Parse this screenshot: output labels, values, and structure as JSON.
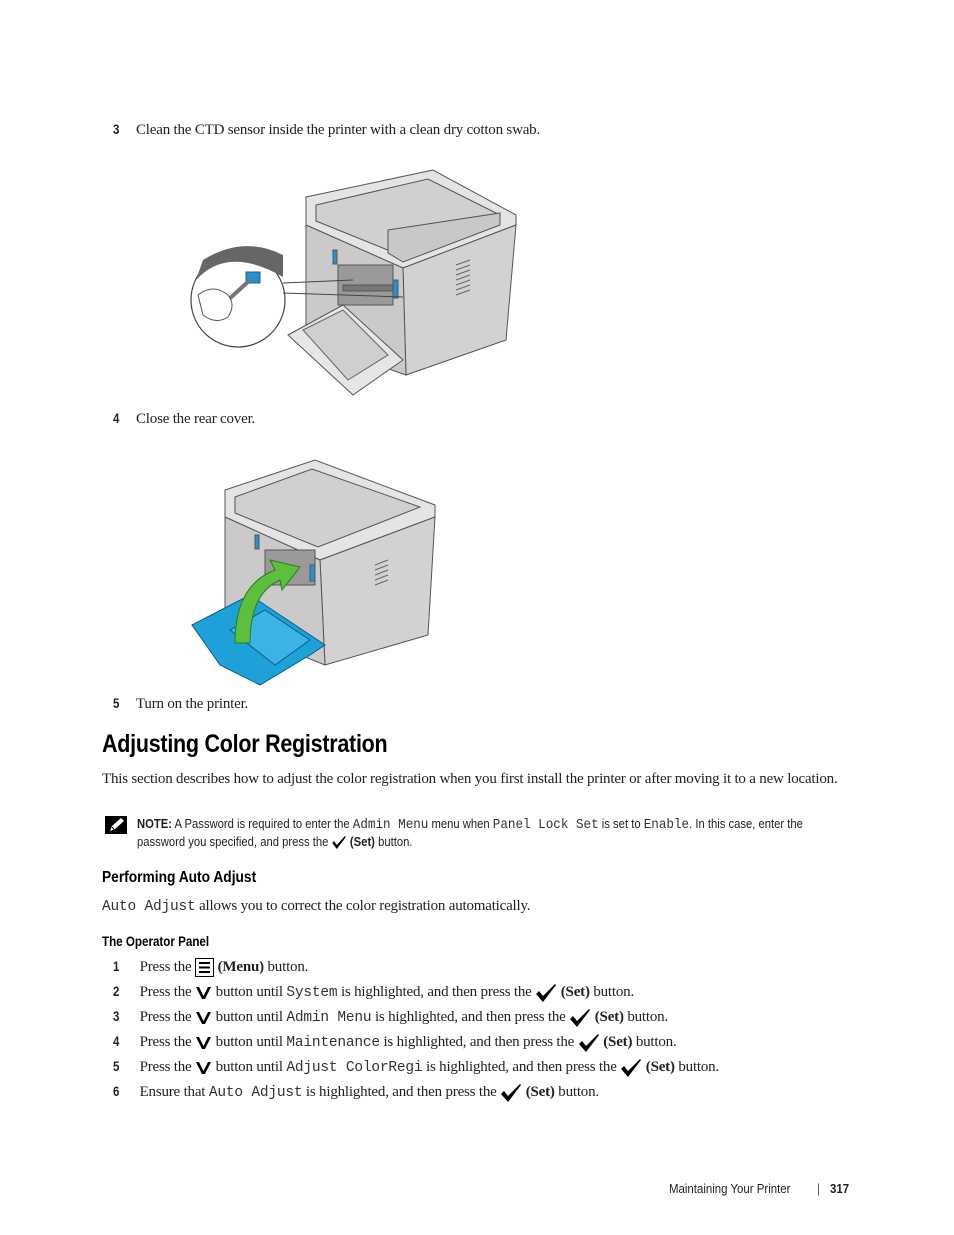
{
  "steps_top": [
    {
      "num": "3",
      "text": "Clean the CTD sensor inside the printer with a clean dry cotton swab."
    },
    {
      "num": "4",
      "text": "Close the rear cover."
    },
    {
      "num": "5",
      "text": "Turn on the printer."
    }
  ],
  "figures": {
    "clean_sensor": "printer-rear-clean-ctd-sensor-illustration",
    "close_cover": "printer-rear-close-cover-illustration"
  },
  "colors": {
    "cover_blue": "#1ea1d8",
    "arrow_green": "#5cbf3e",
    "sensor_blue": "#2a8fd0",
    "body_gray": "#d9d9d9"
  },
  "section": {
    "title": "Adjusting Color Registration",
    "intro": "This section describes how to adjust the color registration when you first install the printer or after moving it to a new location.",
    "note": {
      "label": "NOTE:",
      "text_a": "A Password is required to enter the",
      "code_a": "Admin Menu",
      "text_b": "menu when",
      "code_b": "Panel Lock Set",
      "text_c": "is set to",
      "code_c": "Enable",
      "text_d": ". In this case, enter the password you specified, and press the",
      "set_label": "(Set)",
      "text_e": "button."
    }
  },
  "subsection": {
    "title": "Performing Auto Adjust",
    "intro_code": "Auto Adjust",
    "intro_text": "allows you to correct the color registration automatically."
  },
  "operator_panel": {
    "title": "The Operator Panel",
    "steps": [
      {
        "num": "1",
        "pre": "Press the",
        "icon": "menu-icon",
        "label": "(Menu)",
        "post": "button."
      },
      {
        "num": "2",
        "pre": "Press the",
        "icon": "down-arrow-icon",
        "mid": "button until",
        "code": "System",
        "after": "is highlighted, and then press the",
        "set": "(Set)",
        "post": "button."
      },
      {
        "num": "3",
        "pre": "Press the",
        "icon": "down-arrow-icon",
        "mid": "button until",
        "code": "Admin Menu",
        "after": "is highlighted, and then press the",
        "set": "(Set)",
        "post": "button."
      },
      {
        "num": "4",
        "pre": "Press the",
        "icon": "down-arrow-icon",
        "mid": "button until",
        "code": "Maintenance",
        "after": "is highlighted, and then press the",
        "set": "(Set)",
        "post": "button."
      },
      {
        "num": "5",
        "pre": "Press the",
        "icon": "down-arrow-icon",
        "mid": "button until",
        "code": "Adjust ColorRegi",
        "after": "is highlighted, and then press the",
        "set": "(Set)",
        "post": "button."
      },
      {
        "num": "6",
        "pre": "Ensure that",
        "code": "Auto Adjust",
        "after": "is highlighted, and then press the",
        "set": "(Set)",
        "post": "button."
      }
    ]
  },
  "footer": {
    "chapter": "Maintaining Your Printer",
    "separator": "|",
    "page": "317"
  }
}
